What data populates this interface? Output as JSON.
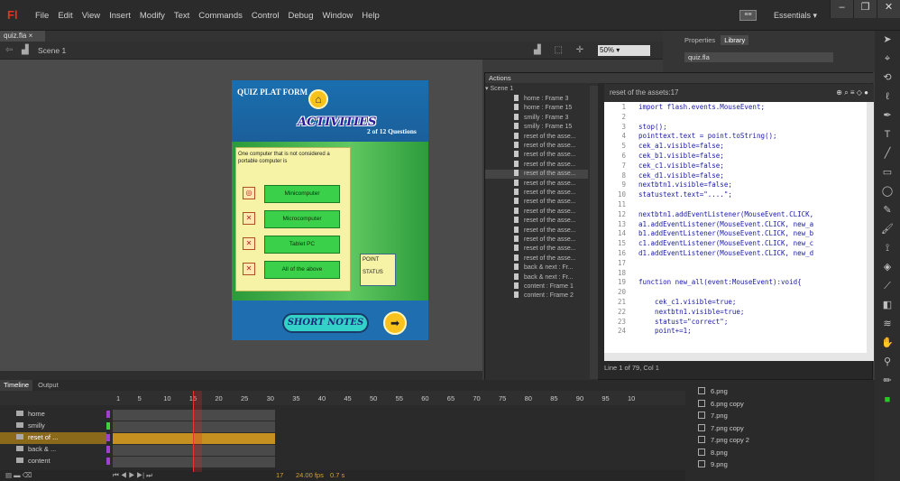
{
  "app": {
    "logo": "Fl",
    "workspace_icon": "≡≡",
    "workspace": "Essentials"
  },
  "menu": [
    "File",
    "Edit",
    "View",
    "Insert",
    "Modify",
    "Text",
    "Commands",
    "Control",
    "Debug",
    "Window",
    "Help"
  ],
  "doc_tab": "quiz.fla",
  "scene_label": "Scene 1",
  "zoom": "50%",
  "stage": {
    "platform": "QUIZ PLAT FORM",
    "activities": "ACTIVITIES",
    "question_count": "2 of 12 Questions",
    "question": "One computer that is not considered a portable computer is",
    "options": [
      "Minicomputer",
      "Microcomputer",
      "Tablet PC",
      "All of the above"
    ],
    "point_label": "POINT",
    "status_label": "STATUS",
    "short_notes": "SHORT NOTES"
  },
  "actions": {
    "title": "Actions",
    "tree_root": "Scene 1",
    "tree": [
      "home : Frame 3",
      "home : Frame 15",
      "smilly : Frame 3",
      "smilly : Frame 15",
      "reset of the asse...",
      "reset of the asse...",
      "reset of the asse...",
      "reset of the asse...",
      "reset of the asse...",
      "reset of the asse...",
      "reset of the asse...",
      "reset of the asse...",
      "reset of the asse...",
      "reset of the asse...",
      "reset of the asse...",
      "reset of the asse...",
      "reset of the asse...",
      "reset of the asse...",
      "back & next : Fr...",
      "back & next : Fr...",
      "content : Frame 1",
      "content : Frame 2"
    ],
    "editor_title": "reset of the assets:17",
    "code": [
      "import flash.events.MouseEvent;",
      "",
      "stop();",
      "pointtext.text = point.toString();",
      "cek_a1.visible=false;",
      "cek_b1.visible=false;",
      "cek_c1.visible=false;",
      "cek_d1.visible=false;",
      "nextbtn1.visible=false;",
      "statustext.text=\"....\";",
      "",
      "nextbtn1.addEventListener(MouseEvent.CLICK,",
      "a1.addEventListener(MouseEvent.CLICK, new_a",
      "b1.addEventListener(MouseEvent.CLICK, new_b",
      "c1.addEventListener(MouseEvent.CLICK, new_c",
      "d1.addEventListener(MouseEvent.CLICK, new_d",
      "",
      "",
      "function new_all(event:MouseEvent):void{",
      "",
      "    cek_c1.visible=true;",
      "    nextbtn1.visible=true;",
      "    statust=\"correct\";",
      "    point+=1;"
    ],
    "status": "Line 1 of 79, Col 1"
  },
  "panel": {
    "properties_tab": "Properties",
    "library_tab": "Library",
    "doc_select": "quiz.fla"
  },
  "timeline": {
    "tabs": [
      "Timeline",
      "Output"
    ],
    "ruler": [
      "1",
      "5",
      "10",
      "15",
      "20",
      "25",
      "30",
      "35",
      "40",
      "45",
      "50",
      "55",
      "60",
      "65",
      "70",
      "75",
      "80",
      "85",
      "90",
      "95",
      "10"
    ],
    "layers": [
      {
        "name": "home",
        "color": "#a040d0"
      },
      {
        "name": "smilly",
        "color": "#40d040"
      },
      {
        "name": "reset of ...",
        "color": "#a040d0"
      },
      {
        "name": "back & ...",
        "color": "#a040d0"
      },
      {
        "name": "content",
        "color": "#a040d0"
      }
    ],
    "frame": "17",
    "fps": "24.00 fps",
    "time": "0.7 s"
  },
  "library_items": [
    "6.png",
    "6.png copy",
    "7.png",
    "7.png copy",
    "7.png copy 2",
    "8.png",
    "9.png"
  ]
}
